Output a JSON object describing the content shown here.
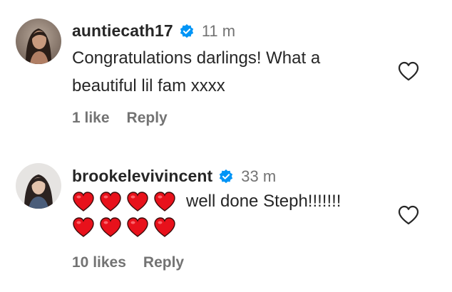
{
  "comments": [
    {
      "username": "auntiecath17",
      "time": "11 m",
      "text": "Congratulations darlings! What a beautiful lil fam xxxx",
      "likes": "1 like",
      "reply": "Reply",
      "verified": true,
      "avatar_icon": "avatar-photo-icon",
      "heart_icon": "heart-outline-icon"
    },
    {
      "username": "brookelevivincent",
      "time": "33 m",
      "emoji_count_line1": 4,
      "text": "well done Steph!!!!!!!",
      "emoji_count_line2": 4,
      "emoji": "red-heart-emoji",
      "likes": "10 likes",
      "reply": "Reply",
      "verified": true,
      "avatar_icon": "avatar-photo-icon",
      "heart_icon": "heart-outline-icon"
    }
  ],
  "colors": {
    "text": "#262626",
    "secondary": "#737373",
    "verified": "#0095f6",
    "heart_emoji": "#e8111b"
  }
}
